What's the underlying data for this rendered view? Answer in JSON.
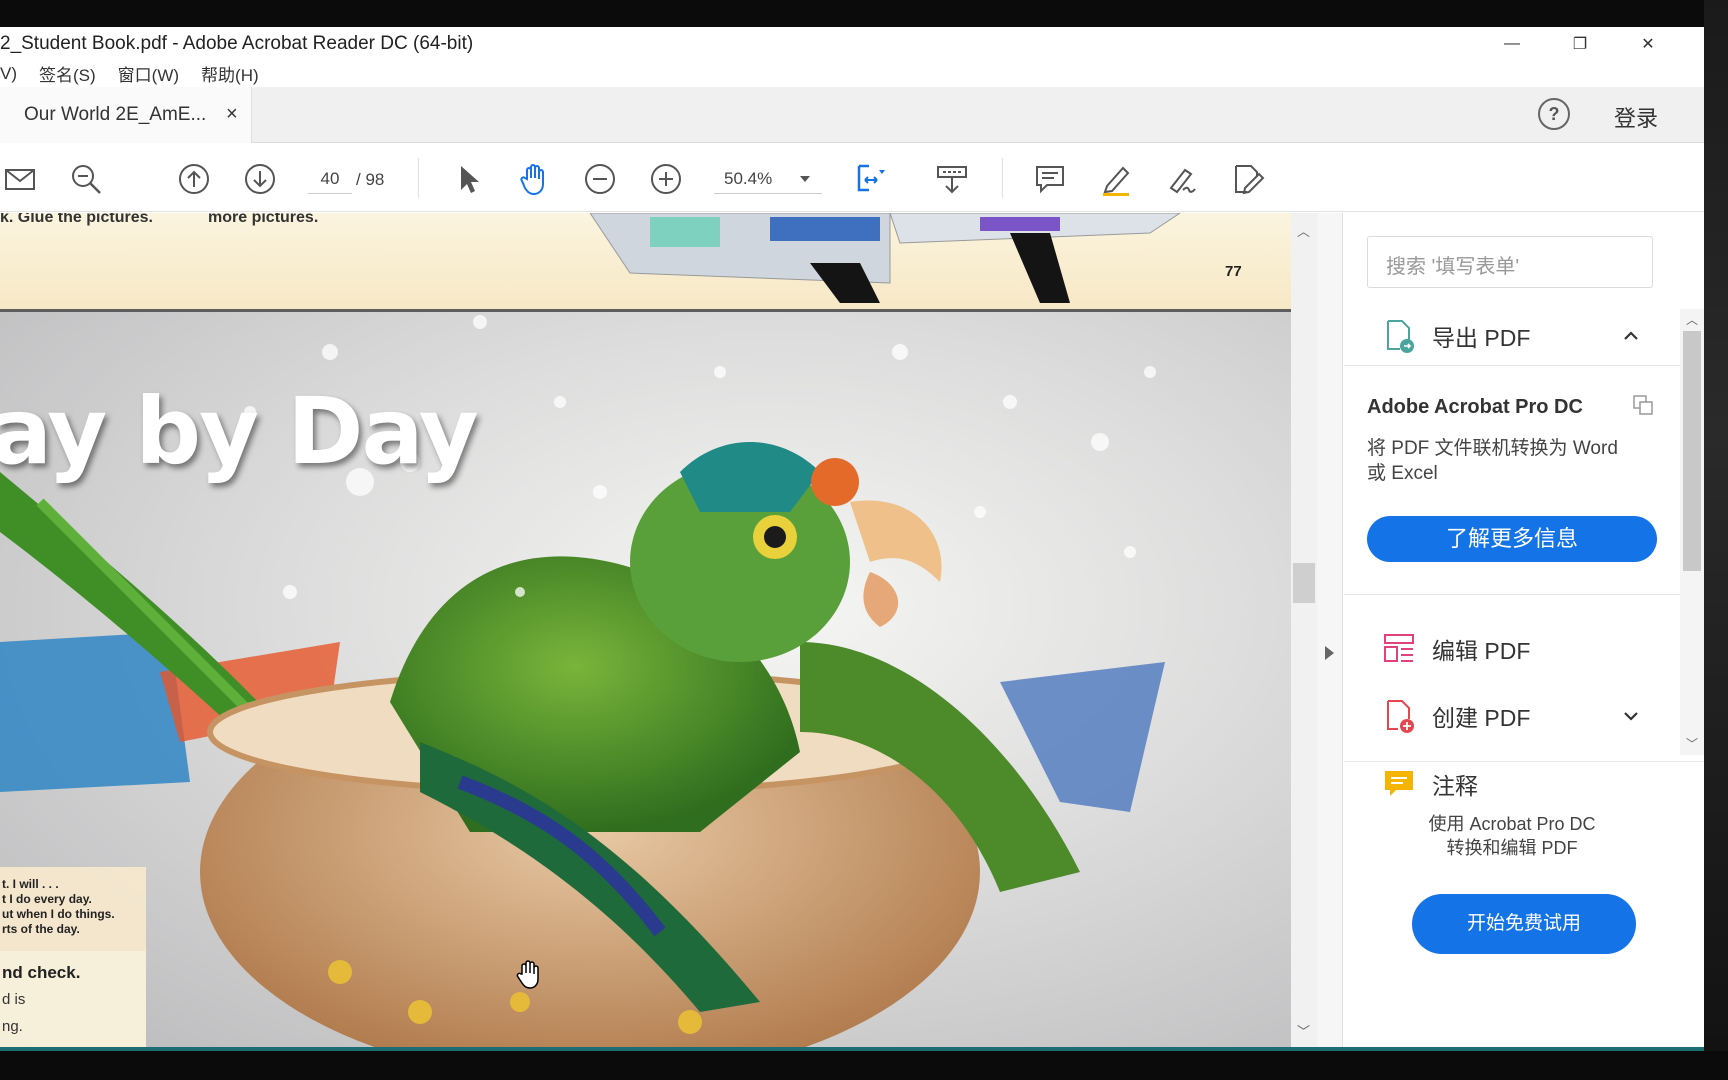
{
  "window": {
    "title": "2_Student Book.pdf - Adobe Acrobat Reader DC (64-bit)",
    "minimize_glyph": "—",
    "restore_glyph": "❐",
    "close_glyph": "✕"
  },
  "menu": {
    "items": [
      "V)",
      "签名(S)",
      "窗口(W)",
      "帮助(H)"
    ]
  },
  "tabs": {
    "doc_tab_label": "Our World 2E_AmE...",
    "close_glyph": "×",
    "help_glyph": "?",
    "login_label": "登录"
  },
  "toolbar": {
    "current_page": "40",
    "total_pages": "/ 98",
    "zoom": "50.4%"
  },
  "document": {
    "top_snippets": [
      "k. Glue the pictures.",
      "more pictures."
    ],
    "page_number": "77",
    "photo_title": "ay by Day",
    "note_lines": [
      "t. I will . . .",
      "t I do every day.",
      "ut when I do things.",
      "rts of the day."
    ],
    "check_heading": "nd check.",
    "check_lines": [
      "d is",
      "ng."
    ]
  },
  "right_pane": {
    "search_placeholder": "搜索 '填写表单'",
    "export_label": "导出 PDF",
    "promo_title": "Adobe Acrobat Pro DC",
    "promo_desc": "将 PDF 文件联机转换为 Word 或 Excel",
    "promo_button": "了解更多信息",
    "edit_label": "编辑 PDF",
    "create_label": "创建 PDF",
    "comment_label": "注释",
    "bottom_text_1": "使用 Acrobat Pro DC",
    "bottom_text_2": "转换和编辑 PDF",
    "trial_button": "开始免费试用"
  },
  "colors": {
    "accent_blue": "#1473e6",
    "export_icon": "#4ba59e",
    "edit_icon": "#e0437b",
    "create_icon": "#e34850",
    "comment_icon": "#f4b400"
  },
  "icons": {
    "toolbar": [
      "mail-icon",
      "zoom-search-icon",
      "page-up-icon",
      "page-down-icon",
      "select-cursor-icon",
      "hand-tool-icon",
      "zoom-out-icon",
      "zoom-in-icon",
      "fit-page-icon",
      "read-mode-icon",
      "comment-icon",
      "highlight-icon",
      "sign-icon",
      "edit-tools-icon"
    ]
  }
}
